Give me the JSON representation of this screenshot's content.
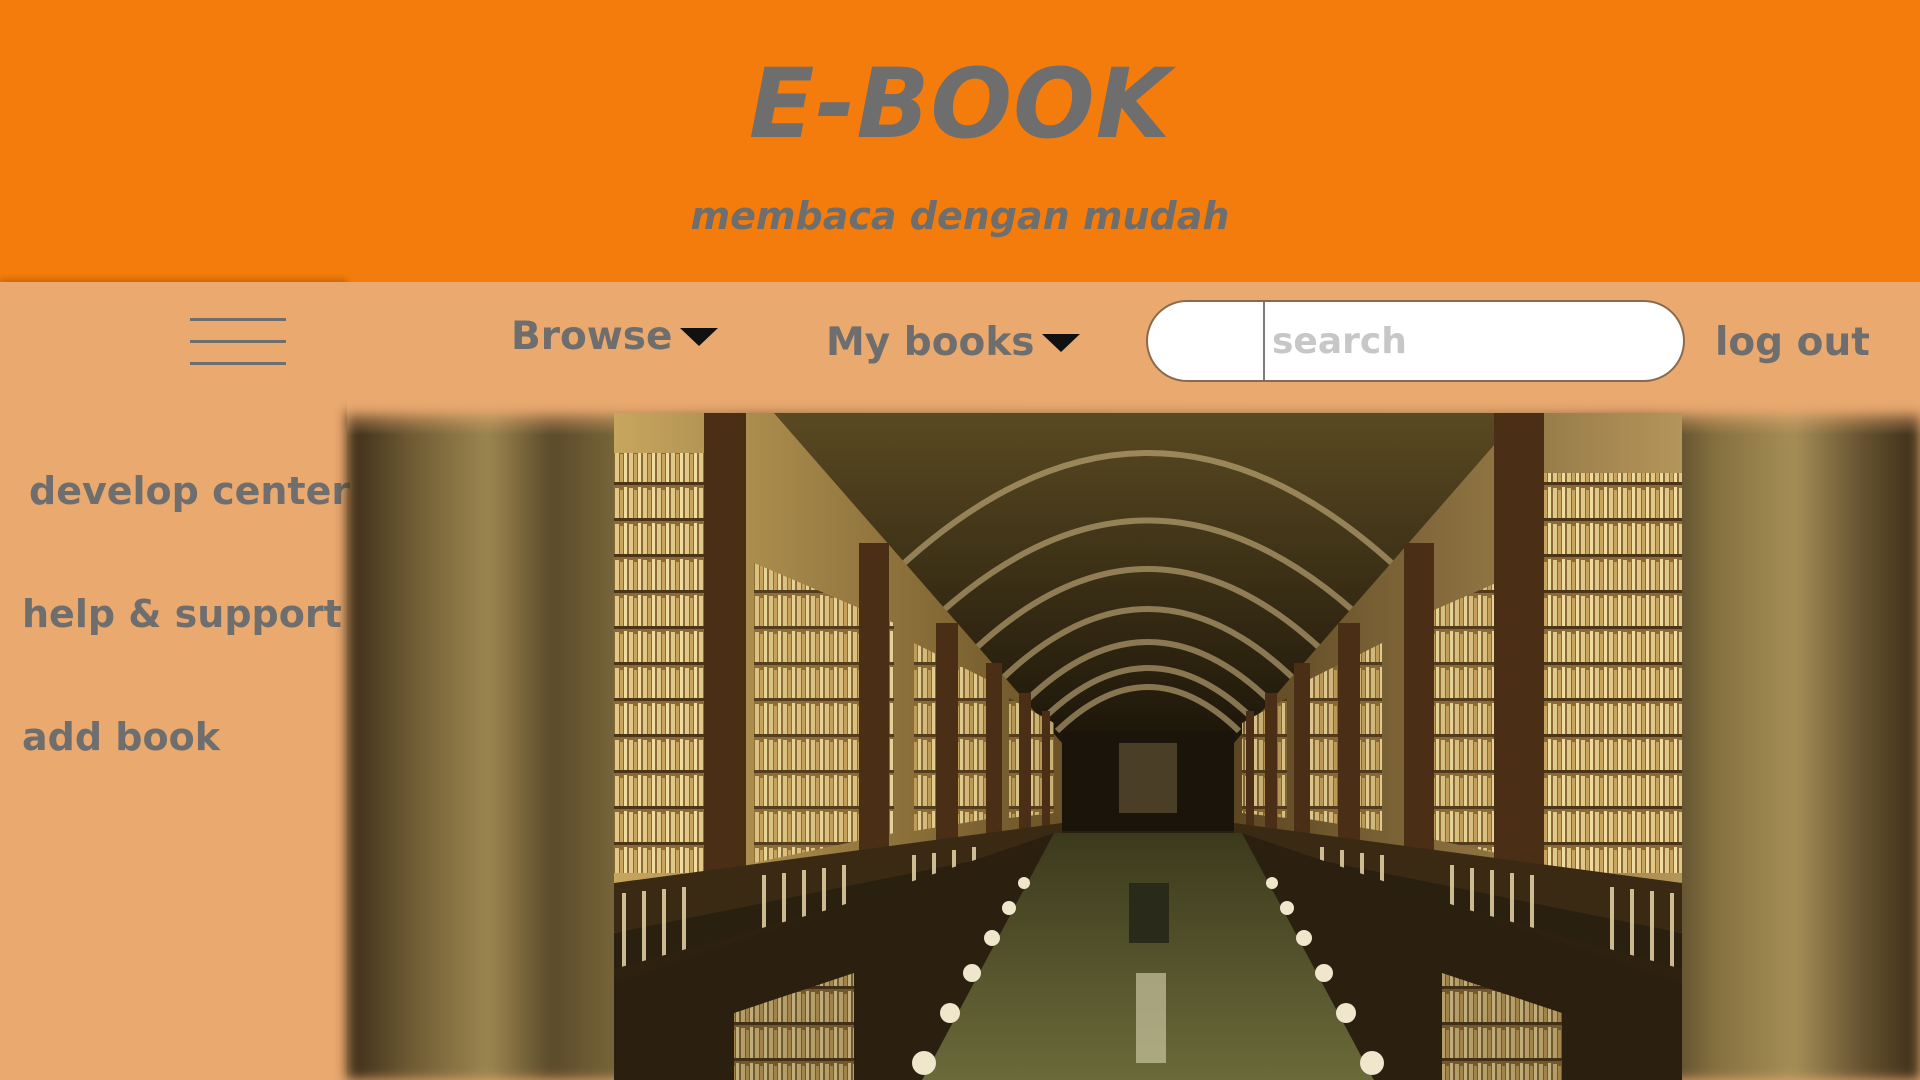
{
  "header": {
    "title": "E-BOOK",
    "subtitle": "membaca dengan mudah",
    "background_color": "#f47c0c",
    "text_color": "#6e6e6e"
  },
  "sidebar": {
    "menu_icon": "hamburger-menu-icon",
    "items": [
      {
        "label": "develop center"
      },
      {
        "label": "help & support"
      },
      {
        "label": "add book"
      }
    ],
    "background_color": "#e9a96f"
  },
  "nav": {
    "browse_label": "Browse",
    "browse_icon": "caret-down-icon",
    "my_books_label": "My books",
    "my_books_icon": "caret-down-icon",
    "search_placeholder": "search",
    "logout_label": "log out"
  },
  "hero": {
    "image": "library-hall-photo"
  }
}
